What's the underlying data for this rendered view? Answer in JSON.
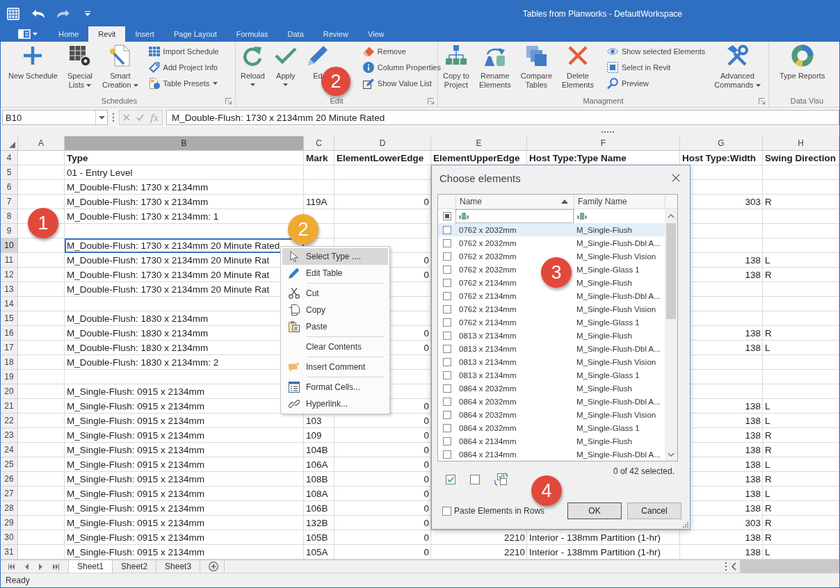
{
  "window": {
    "title": "Tables from Planworks - DefaultWorkspace"
  },
  "ribbon": {
    "tabs": [
      {
        "label": "Home",
        "selected": false
      },
      {
        "label": "Revit",
        "selected": true
      },
      {
        "label": "Insert",
        "selected": false
      },
      {
        "label": "Page Layout",
        "selected": false
      },
      {
        "label": "Formulas",
        "selected": false
      },
      {
        "label": "Data",
        "selected": false
      },
      {
        "label": "Review",
        "selected": false
      },
      {
        "label": "View",
        "selected": false
      }
    ],
    "groups": [
      {
        "label": "Schedules",
        "launcher": true,
        "items": [
          {
            "kind": "large",
            "lines": [
              "New Schedule"
            ],
            "dropdown": false
          },
          {
            "kind": "large",
            "lines": [
              "Special",
              "Lists"
            ],
            "dropdown": true
          },
          {
            "kind": "large",
            "lines": [
              "Smart",
              "Creation"
            ],
            "dropdown": true
          },
          {
            "kind": "stack",
            "buttons": [
              {
                "label": "Import Schedule",
                "dropdown": false
              },
              {
                "label": "Add Project Info",
                "dropdown": false
              },
              {
                "label": "Table Presets",
                "dropdown": true
              }
            ]
          }
        ]
      },
      {
        "label": "Edit",
        "launcher": true,
        "items": [
          {
            "kind": "large",
            "lines": [
              "Reload"
            ],
            "dropdown": true
          },
          {
            "kind": "large",
            "lines": [
              "Apply"
            ],
            "dropdown": true
          },
          {
            "kind": "large",
            "lines": [
              "Ed"
            ],
            "dropdown": false
          },
          {
            "kind": "stack",
            "buttons": [
              {
                "label": "Remove",
                "dropdown": false
              },
              {
                "label": "Column Properties",
                "dropdown": false
              },
              {
                "label": "Show Value List",
                "dropdown": false
              }
            ]
          }
        ],
        "callout": {
          "number": "2",
          "color": "#e2493d"
        }
      },
      {
        "label": "Managment",
        "launcher": true,
        "items": [
          {
            "kind": "large",
            "lines": [
              "Copy to",
              "Project"
            ],
            "dropdown": false
          },
          {
            "kind": "large",
            "lines": [
              "Rename",
              "Elements"
            ],
            "dropdown": false
          },
          {
            "kind": "large",
            "lines": [
              "Compare",
              "Tables"
            ],
            "dropdown": false
          },
          {
            "kind": "large",
            "lines": [
              "Delete",
              "Elements"
            ],
            "dropdown": false
          },
          {
            "kind": "stack",
            "buttons": [
              {
                "label": "Show selected Elements",
                "dropdown": false
              },
              {
                "label": "Select in Revit",
                "dropdown": false
              },
              {
                "label": "Preview",
                "dropdown": false
              }
            ]
          },
          {
            "kind": "large",
            "lines": [
              "Advanced",
              "Commands"
            ],
            "dropdown": true
          }
        ]
      },
      {
        "label": "Data Visu",
        "launcher": false,
        "items": [
          {
            "kind": "large",
            "lines": [
              "Type Reports"
            ],
            "dropdown": false
          }
        ]
      }
    ]
  },
  "formula_bar": {
    "name_box": "B10",
    "disabled": true,
    "function_label": "fx",
    "formula": "M_Double-Flush: 1730 x 2134mm 20 Minute Rated"
  },
  "sheet": {
    "columns": [
      {
        "letter": "A",
        "kind": "text",
        "selected": false
      },
      {
        "letter": "B",
        "kind": "text",
        "selected": true
      },
      {
        "letter": "C",
        "kind": "text",
        "selected": false
      },
      {
        "letter": "D",
        "kind": "number",
        "selected": false
      },
      {
        "letter": "E",
        "kind": "number",
        "selected": false
      },
      {
        "letter": "F",
        "kind": "text",
        "selected": false
      },
      {
        "letter": "G",
        "kind": "number",
        "selected": false
      },
      {
        "letter": "H",
        "kind": "text",
        "selected": false
      }
    ],
    "rows": [
      {
        "number": "4",
        "kind": "header",
        "selected": false,
        "cells": {
          "B": "Type",
          "C": "Mark",
          "D": "ElementLowerEdge",
          "E": "ElementUpperEdge",
          "F": "Host Type:Type Name",
          "G": "Host Type:Width",
          "H": "Swing Direction"
        }
      },
      {
        "number": "5",
        "kind": "data",
        "selected": false,
        "cells": {
          "B": "01 - Entry Level"
        }
      },
      {
        "number": "6",
        "kind": "data",
        "selected": false,
        "cells": {
          "B": "M_Double-Flush: 1730 x 2134mm"
        }
      },
      {
        "number": "7",
        "kind": "data",
        "selected": false,
        "cells": {
          "B": "M_Double-Flush: 1730 x 2134mm",
          "C": "119A",
          "D": "0",
          "G": "303",
          "H": "R"
        }
      },
      {
        "number": "8",
        "kind": "data",
        "selected": false,
        "cells": {
          "B": "M_Double-Flush: 1730 x 2134mm: 1"
        }
      },
      {
        "number": "9",
        "kind": "data",
        "selected": false
      },
      {
        "number": "10",
        "kind": "data",
        "selected": true,
        "cells": {
          "B": "M_Double-Flush: 1730 x 2134mm 20 Minute Rated"
        }
      },
      {
        "number": "11",
        "kind": "data",
        "selected": false,
        "cells": {
          "B": "M_Double-Flush: 1730 x 2134mm 20 Minute Rat",
          "D": "0",
          "G": "138",
          "H": "L"
        }
      },
      {
        "number": "12",
        "kind": "data",
        "selected": false,
        "cells": {
          "B": "M_Double-Flush: 1730 x 2134mm 20 Minute Rat",
          "D": "0",
          "G": "138",
          "H": "R"
        }
      },
      {
        "number": "13",
        "kind": "data",
        "selected": false,
        "cells": {
          "B": "M_Double-Flush: 1730 x 2134mm 20 Minute Rat"
        }
      },
      {
        "number": "14",
        "kind": "data",
        "selected": false
      },
      {
        "number": "15",
        "kind": "data",
        "selected": false,
        "cells": {
          "B": "M_Double-Flush: 1830 x 2134mm"
        }
      },
      {
        "number": "16",
        "kind": "data",
        "selected": false,
        "cells": {
          "B": "M_Double-Flush: 1830 x 2134mm",
          "D": "0",
          "G": "138",
          "H": "R"
        }
      },
      {
        "number": "17",
        "kind": "data",
        "selected": false,
        "cells": {
          "B": "M_Double-Flush: 1830 x 2134mm",
          "D": "0",
          "G": "138",
          "H": "L"
        }
      },
      {
        "number": "18",
        "kind": "data",
        "selected": false,
        "cells": {
          "B": "M_Double-Flush: 1830 x 2134mm: 2"
        }
      },
      {
        "number": "19",
        "kind": "data",
        "selected": false
      },
      {
        "number": "20",
        "kind": "data",
        "selected": false,
        "cells": {
          "B": "M_Single-Flush: 0915 x 2134mm"
        }
      },
      {
        "number": "21",
        "kind": "data",
        "selected": false,
        "cells": {
          "B": "M_Single-Flush: 0915 x 2134mm",
          "D": "0",
          "G": "138",
          "H": "L"
        }
      },
      {
        "number": "22",
        "kind": "data",
        "selected": false,
        "cells": {
          "B": "M_Single-Flush: 0915 x 2134mm",
          "C": "103",
          "D": "0",
          "G": "138",
          "H": "L"
        }
      },
      {
        "number": "23",
        "kind": "data",
        "selected": false,
        "cells": {
          "B": "M_Single-Flush: 0915 x 2134mm",
          "C": "109",
          "D": "0",
          "G": "138",
          "H": "R"
        }
      },
      {
        "number": "24",
        "kind": "data",
        "selected": false,
        "cells": {
          "B": "M_Single-Flush: 0915 x 2134mm",
          "C": "104B",
          "D": "0",
          "G": "138",
          "H": "R"
        }
      },
      {
        "number": "25",
        "kind": "data",
        "selected": false,
        "cells": {
          "B": "M_Single-Flush: 0915 x 2134mm",
          "C": "106A",
          "D": "0",
          "G": "138",
          "H": "L"
        }
      },
      {
        "number": "26",
        "kind": "data",
        "selected": false,
        "cells": {
          "B": "M_Single-Flush: 0915 x 2134mm",
          "C": "108B",
          "D": "0",
          "G": "138",
          "H": "R"
        }
      },
      {
        "number": "27",
        "kind": "data",
        "selected": false,
        "cells": {
          "B": "M_Single-Flush: 0915 x 2134mm",
          "C": "108A",
          "D": "0",
          "G": "138",
          "H": "L"
        }
      },
      {
        "number": "28",
        "kind": "data",
        "selected": false,
        "cells": {
          "B": "M_Single-Flush: 0915 x 2134mm",
          "C": "106B",
          "D": "0",
          "G": "138",
          "H": "R"
        }
      },
      {
        "number": "29",
        "kind": "data",
        "selected": false,
        "cells": {
          "B": "M_Single-Flush: 0915 x 2134mm",
          "C": "132B",
          "D": "0",
          "G": "303",
          "H": "R"
        }
      },
      {
        "number": "30",
        "kind": "data",
        "selected": false,
        "cells": {
          "B": "M_Single-Flush: 0915 x 2134mm",
          "C": "105B",
          "D": "0",
          "E": "2210",
          "F": "Interior - 138mm Partition (1-hr)",
          "G": "138",
          "H": "R"
        }
      },
      {
        "number": "31",
        "kind": "data",
        "selected": false,
        "cells": {
          "B": "M_Single-Flush: 0915 x 2134mm",
          "C": "105A",
          "D": "0",
          "E": "2210",
          "F": "Interior - 138mm Partition (1-hr)",
          "G": "138",
          "H": "L"
        }
      }
    ],
    "callouts": [
      {
        "number": "1",
        "color": "#e2493d"
      },
      {
        "number": "2",
        "color": "#f0aa33"
      }
    ]
  },
  "context_menu": {
    "sections": [
      {
        "items": [
          {
            "label": "Select Type ....",
            "selected": true
          },
          {
            "label": "Edit Table",
            "selected": false
          }
        ]
      },
      {
        "items": [
          {
            "label": "Cut",
            "selected": false
          },
          {
            "label": "Copy",
            "selected": false
          },
          {
            "label": "Paste",
            "selected": false
          }
        ]
      },
      {
        "items": [
          {
            "label": "Clear Contents",
            "selected": false
          }
        ]
      },
      {
        "items": [
          {
            "label": "Insert Comment",
            "selected": false
          }
        ]
      },
      {
        "items": [
          {
            "label": "Format Cells...",
            "selected": false
          },
          {
            "label": "Hyperlink...",
            "selected": false
          }
        ]
      }
    ]
  },
  "dialog": {
    "title": "Choose elements",
    "columns": [
      {
        "label": "Name",
        "sorted": true
      },
      {
        "label": "Family Name",
        "sorted": false
      }
    ],
    "select_all": {
      "indeterminate": true
    },
    "rows": [
      {
        "name": "0762 x 2032mm",
        "family": "M_Single-Flush",
        "checked": false,
        "selected": true
      },
      {
        "name": "0762 x 2032mm",
        "family": "M_Single-Flush-Dbl A...",
        "checked": false,
        "selected": false
      },
      {
        "name": "0762 x 2032mm",
        "family": "M_Single-Flush Vision",
        "checked": false,
        "selected": false
      },
      {
        "name": "0762 x 2032mm",
        "family": "M_Single-Glass 1",
        "checked": false,
        "selected": false
      },
      {
        "name": "0762 x 2134mm",
        "family": "M_Single-Flush",
        "checked": false,
        "selected": false
      },
      {
        "name": "0762 x 2134mm",
        "family": "M_Single-Flush-Dbl A...",
        "checked": false,
        "selected": false
      },
      {
        "name": "0762 x 2134mm",
        "family": "M_Single-Flush Vision",
        "checked": false,
        "selected": false
      },
      {
        "name": "0762 x 2134mm",
        "family": "M_Single-Glass 1",
        "checked": false,
        "selected": false
      },
      {
        "name": "0813 x 2134mm",
        "family": "M_Single-Flush",
        "checked": false,
        "selected": false
      },
      {
        "name": "0813 x 2134mm",
        "family": "M_Single-Flush-Dbl A...",
        "checked": false,
        "selected": false
      },
      {
        "name": "0813 x 2134mm",
        "family": "M_Single-Flush Vision",
        "checked": false,
        "selected": false
      },
      {
        "name": "0813 x 2134mm",
        "family": "M_Single-Glass 1",
        "checked": false,
        "selected": false
      },
      {
        "name": "0864 x 2032mm",
        "family": "M_Single-Flush",
        "checked": false,
        "selected": false
      },
      {
        "name": "0864 x 2032mm",
        "family": "M_Single-Flush-Dbl A...",
        "checked": false,
        "selected": false
      },
      {
        "name": "0864 x 2032mm",
        "family": "M_Single-Flush Vision",
        "checked": false,
        "selected": false
      },
      {
        "name": "0864 x 2032mm",
        "family": "M_Single-Glass 1",
        "checked": false,
        "selected": false
      },
      {
        "name": "0864 x 2134mm",
        "family": "M_Single-Flush",
        "checked": false,
        "selected": false
      },
      {
        "name": "0864 x 2134mm",
        "family": "M_Single-Flush-Dbl A...",
        "checked": false,
        "selected": false
      }
    ],
    "summary": "0 of 42 selected.",
    "paste_in_rows": {
      "label": "Paste Elements in Rows",
      "checked": false
    },
    "buttons": [
      {
        "label": "OK",
        "default": true
      },
      {
        "label": "Cancel",
        "default": false
      }
    ],
    "callouts": [
      {
        "number": "3",
        "color": "#e2493d"
      },
      {
        "number": "4",
        "color": "#e2493d"
      }
    ]
  },
  "sheet_tabs": [
    {
      "label": "Sheet1",
      "selected": true
    },
    {
      "label": "Sheet2",
      "selected": false
    },
    {
      "label": "Sheet3",
      "selected": false
    }
  ],
  "status_bar": {
    "text": "Ready"
  }
}
